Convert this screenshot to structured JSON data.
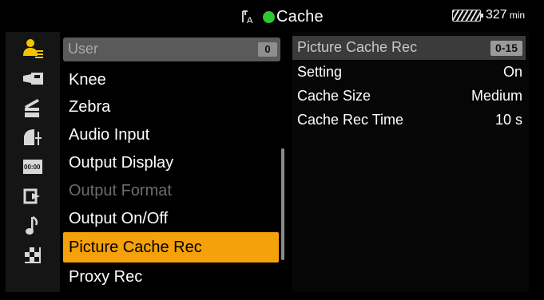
{
  "header": {
    "title": "Cache",
    "media_icon": "media-slot-a-icon",
    "status_color": "#2fc730",
    "battery_icon": "battery-icon",
    "remaining": "327",
    "remaining_unit": "min"
  },
  "sidebar": {
    "icons": [
      {
        "name": "user-menu-icon",
        "active_color": "#f5c400"
      },
      {
        "name": "camera-icon"
      },
      {
        "name": "clapper-icon"
      },
      {
        "name": "paint-icon"
      },
      {
        "name": "timecode-icon"
      },
      {
        "name": "output-icon"
      },
      {
        "name": "audio-note-icon"
      },
      {
        "name": "checker-icon"
      }
    ]
  },
  "menu": {
    "header": {
      "label": "User",
      "badge": "0"
    },
    "items": [
      {
        "label": "Knee",
        "state": "normal"
      },
      {
        "label": "Zebra",
        "state": "normal"
      },
      {
        "label": "Audio Input",
        "state": "normal"
      },
      {
        "label": "Output Display",
        "state": "normal"
      },
      {
        "label": "Output Format",
        "state": "disabled"
      },
      {
        "label": "Output On/Off",
        "state": "normal"
      },
      {
        "label": "Picture Cache Rec",
        "state": "selected"
      },
      {
        "label": "Proxy Rec",
        "state": "normal"
      }
    ],
    "selected_color": "#f5a10a"
  },
  "panel": {
    "header": {
      "label": "Picture Cache Rec",
      "range": "0-15"
    },
    "rows": [
      {
        "label": "Setting",
        "value": "On"
      },
      {
        "label": "Cache Size",
        "value": "Medium"
      },
      {
        "label": "Cache Rec Time",
        "value": "10 s"
      }
    ]
  }
}
